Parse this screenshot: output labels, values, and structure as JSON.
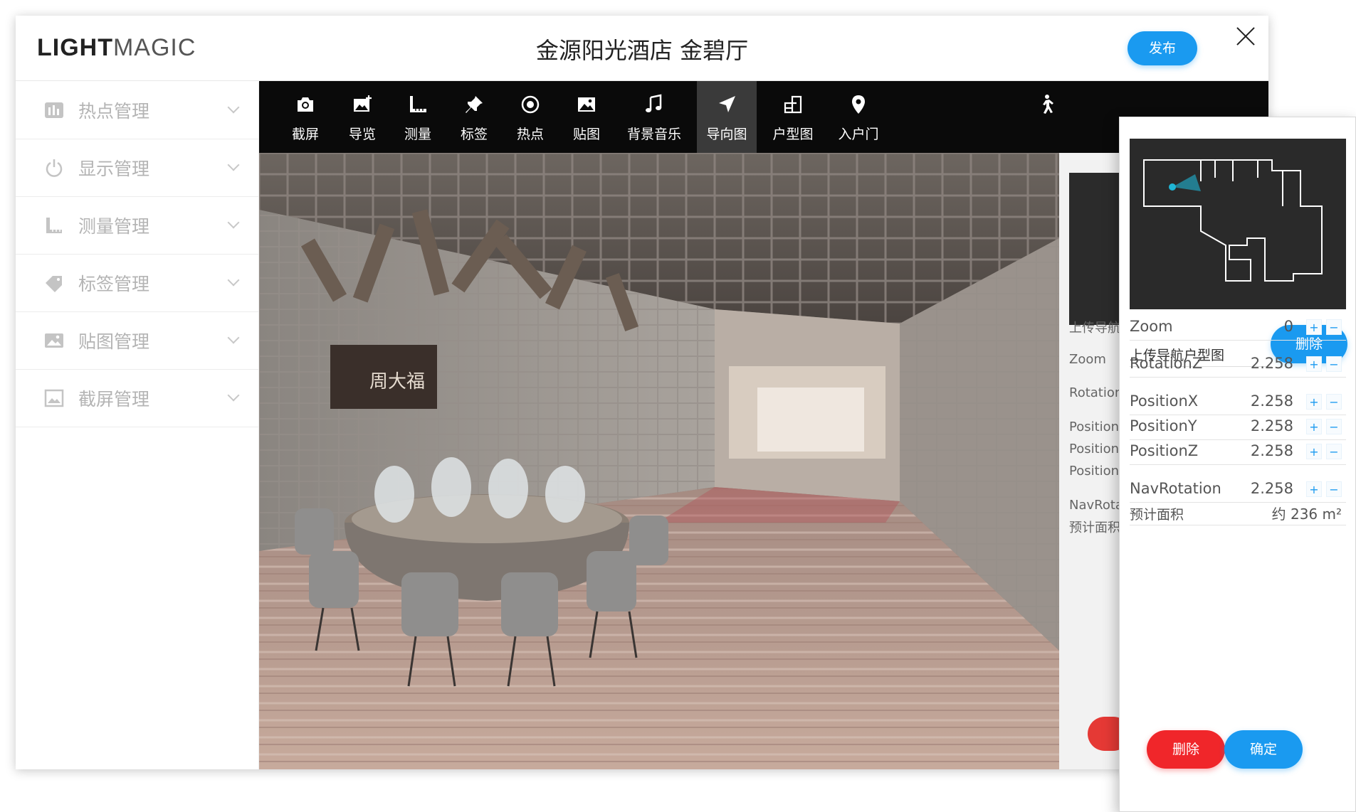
{
  "app": {
    "logo_bold": "LIGHT",
    "logo_light": "MAGIC",
    "title": "金源阳光酒店 金碧厅",
    "publish_label": "发布"
  },
  "sidebar": {
    "items": [
      {
        "label": "热点管理",
        "icon": "bar-chart-icon"
      },
      {
        "label": "显示管理",
        "icon": "power-icon"
      },
      {
        "label": "测量管理",
        "icon": "ruler-icon"
      },
      {
        "label": "标签管理",
        "icon": "tag-icon"
      },
      {
        "label": "贴图管理",
        "icon": "picture-icon"
      },
      {
        "label": "截屏管理",
        "icon": "screenshot-icon"
      }
    ]
  },
  "toolbar": {
    "tools": [
      {
        "label": "截屏",
        "icon": "camera-icon"
      },
      {
        "label": "导览",
        "icon": "tour-image-icon"
      },
      {
        "label": "测量",
        "icon": "ruler-icon"
      },
      {
        "label": "标签",
        "icon": "pin-icon"
      },
      {
        "label": "热点",
        "icon": "hotspot-icon"
      },
      {
        "label": "贴图",
        "icon": "image-icon"
      },
      {
        "label": "背景音乐",
        "icon": "music-icon"
      },
      {
        "label": "导向图",
        "icon": "navigation-arrow-icon",
        "active": true
      },
      {
        "label": "户型图",
        "icon": "floorplan-icon"
      },
      {
        "label": "入户门",
        "icon": "location-pin-icon"
      }
    ],
    "walk_icon": "walk-icon"
  },
  "background_panel": {
    "labels": [
      "上传导航",
      "Zoom",
      "Rotation",
      "Position",
      "Position",
      "Position",
      "NavRota",
      "预计面积"
    ]
  },
  "nav_panel": {
    "upload_label": "上传导航户型图",
    "delete_top_label": "删除",
    "fields": [
      {
        "key": "Zoom",
        "value": "0"
      },
      {
        "key": "RotationZ",
        "value": "2.258"
      },
      {
        "key": "PositionX",
        "value": "2.258"
      },
      {
        "key": "PositionY",
        "value": "2.258"
      },
      {
        "key": "PositionZ",
        "value": "2.258"
      },
      {
        "key": "NavRotation",
        "value": "2.258"
      }
    ],
    "plus": "+",
    "minus": "−",
    "area_label": "预计面积",
    "area_value": "约 236 m²",
    "delete_label": "删除",
    "confirm_label": "确定"
  },
  "colors": {
    "accent_blue": "#1a9af0",
    "danger_red": "#f0262a",
    "toolbar_bg": "#0a0a0a"
  }
}
